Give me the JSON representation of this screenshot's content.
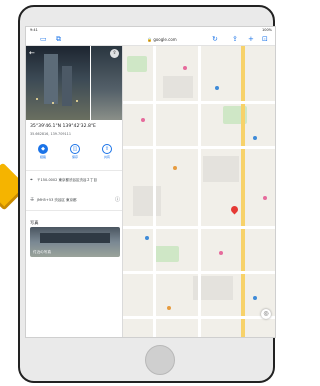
{
  "statusbar": {
    "time": "9:41",
    "battery": "100%"
  },
  "toolbar": {
    "url": "google.com",
    "sidebar_icon": "sidebar-icon",
    "tabs_icon": "tabs-icon",
    "reload_icon": "reload-icon",
    "share_icon": "share-icon",
    "add_icon": "plus-icon"
  },
  "panel": {
    "coords": "35°39'46.1\"N 139°42'32.8\"E",
    "subcoords": "35.662816, 139.709111",
    "actions": [
      {
        "label": "経路",
        "icon": "◆"
      },
      {
        "label": "保存",
        "icon": "◫"
      },
      {
        "label": "共有",
        "icon": "⇪"
      }
    ],
    "address": "〒150-0002 東京都渋谷区渋谷２丁目",
    "plus_code": "JMH5+53 渋谷区 東京都",
    "photos_title": "写真",
    "photo_caption": "付近の写真"
  },
  "colors": {
    "accent": "#1a73e8",
    "pin": "#e53935",
    "frame_arrow": "#f5b400"
  }
}
